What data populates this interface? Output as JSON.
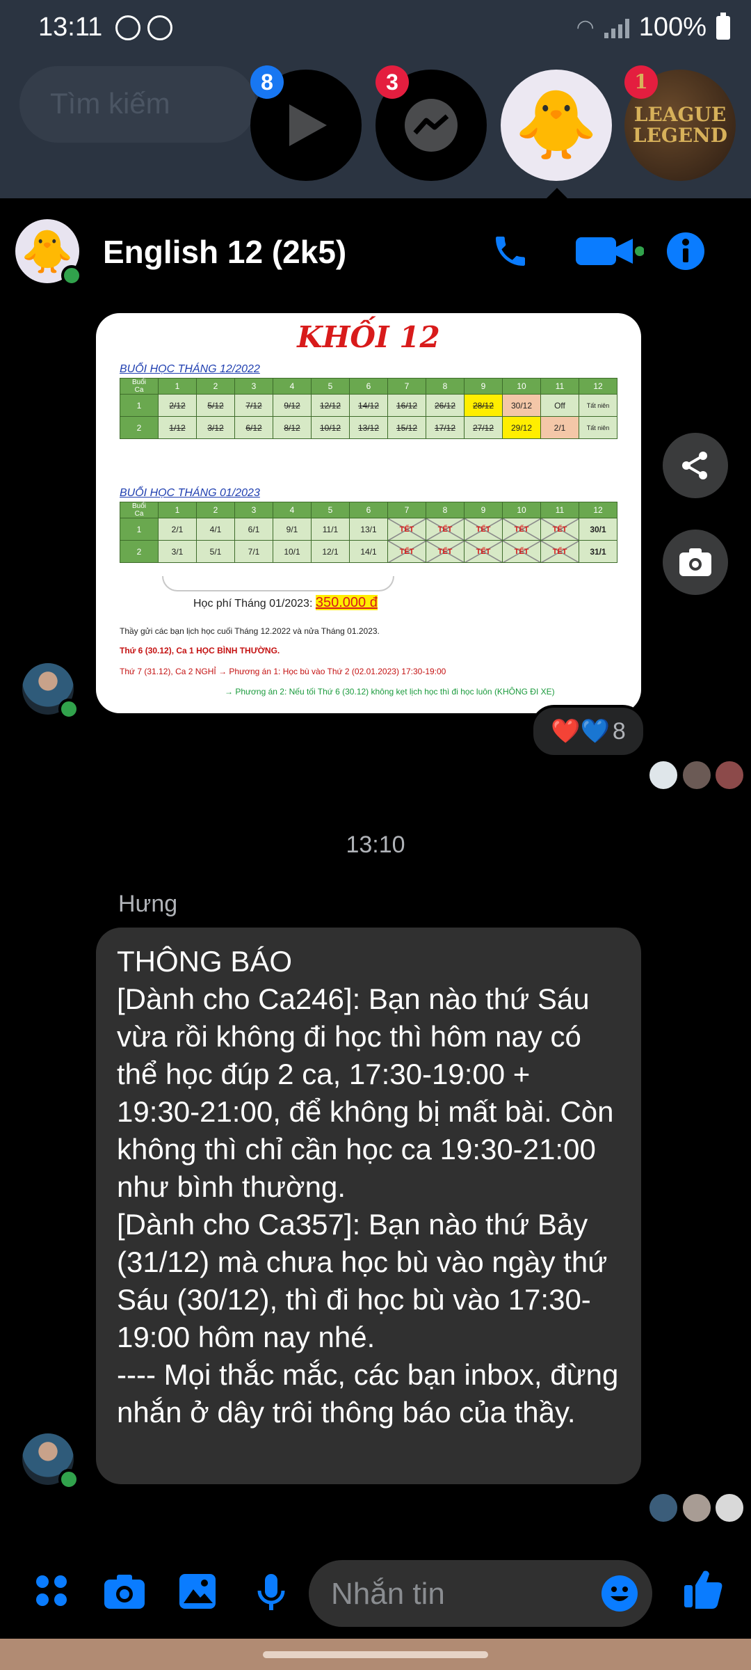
{
  "status": {
    "time": "13:11",
    "battery": "100%"
  },
  "search": {
    "placeholder": "Tìm kiếm"
  },
  "bubbles": [
    {
      "name": "play",
      "badge": "8",
      "badge_color": "#1877f2"
    },
    {
      "name": "messenger",
      "badge": "3",
      "badge_color": "#e41e3f"
    },
    {
      "name": "chick-chat"
    },
    {
      "name": "league",
      "badge": "1",
      "badge_color": "#e41e3f",
      "label": "LEAGUE\nLEGEND"
    }
  ],
  "header": {
    "title": "English 12 (2k5)",
    "accent": "#0a7cff"
  },
  "schedule_image": {
    "title": "KHỐI 12",
    "section1_label": "BUỔI HỌC THÁNG 12/2022",
    "section2_label": "BUỔI HỌC THÁNG 01/2023",
    "header_row": [
      "Buổi\nCa",
      "1",
      "2",
      "3",
      "4",
      "5",
      "6",
      "7",
      "8",
      "9",
      "10",
      "11",
      "12"
    ],
    "dec_rows": [
      [
        "1",
        "2/12",
        "5/12",
        "7/12",
        "9/12",
        "12/12",
        "14/12",
        "16/12",
        "26/12",
        "28/12",
        "30/12",
        "Off",
        "Tất niên"
      ],
      [
        "2",
        "1/12",
        "3/12",
        "6/12",
        "8/12",
        "10/12",
        "13/12",
        "15/12",
        "17/12",
        "27/12",
        "29/12",
        "2/1",
        "Tất niên"
      ]
    ],
    "jan_rows": [
      [
        "1",
        "2/1",
        "4/1",
        "6/1",
        "9/1",
        "11/1",
        "13/1",
        "TẾT",
        "TẾT",
        "TẾT",
        "TẾT",
        "TẾT",
        "30/1"
      ],
      [
        "2",
        "3/1",
        "5/1",
        "7/1",
        "10/1",
        "12/1",
        "14/1",
        "TẾT",
        "TẾT",
        "TẾT",
        "TẾT",
        "TẾT",
        "31/1"
      ]
    ],
    "fee_label": "Học phí Tháng 01/2023:",
    "fee_value": "350.000 đ",
    "notes": [
      "Thầy gửi các bạn lịch học cuối Tháng 12.2022 và nửa Tháng 01.2023.",
      "Thứ 6 (30.12), Ca 1 HỌC BÌNH THƯỜNG.",
      "Thứ 7 (31.12), Ca 2 NGHỈ → Phương án 1: Học bù vào Thứ 2 (02.01.2023) 17:30-19:00",
      "→ Phương án 2: Nếu tối Thứ 6 (30.12) không kẹt lịch học thì đi học luôn (KHÔNG ĐI XE)"
    ]
  },
  "reactions": {
    "emojis": "❤️💙",
    "count": "8"
  },
  "timestamp": "13:10",
  "message": {
    "sender": "Hưng",
    "text": "THÔNG BÁO\n[Dành cho Ca246]: Bạn nào thứ Sáu vừa rồi không đi học thì hôm nay có thể học đúp 2 ca, 17:30-19:00 + 19:30-21:00, để không bị mất bài. Còn không thì chỉ cần học ca 19:30-21:00 như bình thường.\n[Dành cho Ca357]: Bạn nào thứ Bảy (31/12) mà chưa học bù vào ngày thứ Sáu (30/12), thì đi học bù vào 17:30-19:00 hôm nay nhé.\n---- Mọi thắc mắc, các bạn inbox, đừng nhắn ở dây trôi thông báo của thầy."
  },
  "composer": {
    "placeholder": "Nhắn tin"
  }
}
